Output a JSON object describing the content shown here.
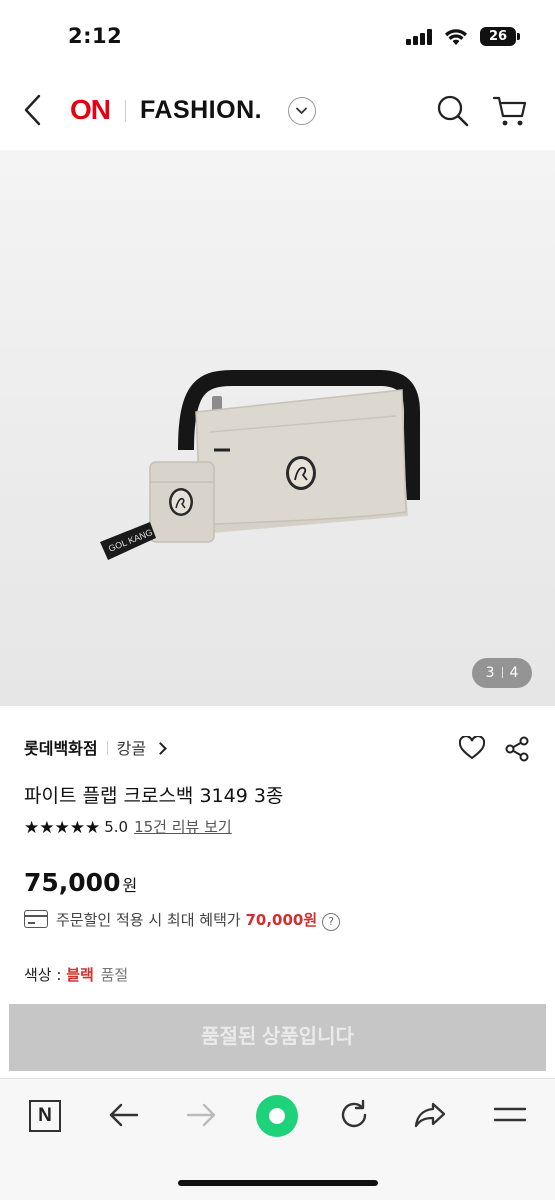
{
  "status_bar": {
    "time": "2:12",
    "battery": "26"
  },
  "header": {
    "logo_on": "ON",
    "logo_fashion": "FASHION."
  },
  "gallery": {
    "current": "3",
    "total": "4"
  },
  "product": {
    "store": "롯데백화점",
    "brand": "캉골",
    "title": "파이트 플랩 크로스백 3149 3종",
    "stars": "★★★★★",
    "rating": "5.0",
    "review_link": "15건 리뷰 보기",
    "price": "75,000",
    "price_unit": "원",
    "benefit_text": "주문할인 적용 시 최대 혜택가",
    "benefit_price": "70,000원",
    "option_label": "색상 :",
    "option_value": "블랙",
    "option_status": "품절",
    "soldout_button": "품절된 상품입니다"
  },
  "colors": {
    "brand_red": "#e60012",
    "accent_red": "#d32f2f",
    "nav_green": "#1ed27a",
    "disabled_button": "#c6c6c6"
  }
}
